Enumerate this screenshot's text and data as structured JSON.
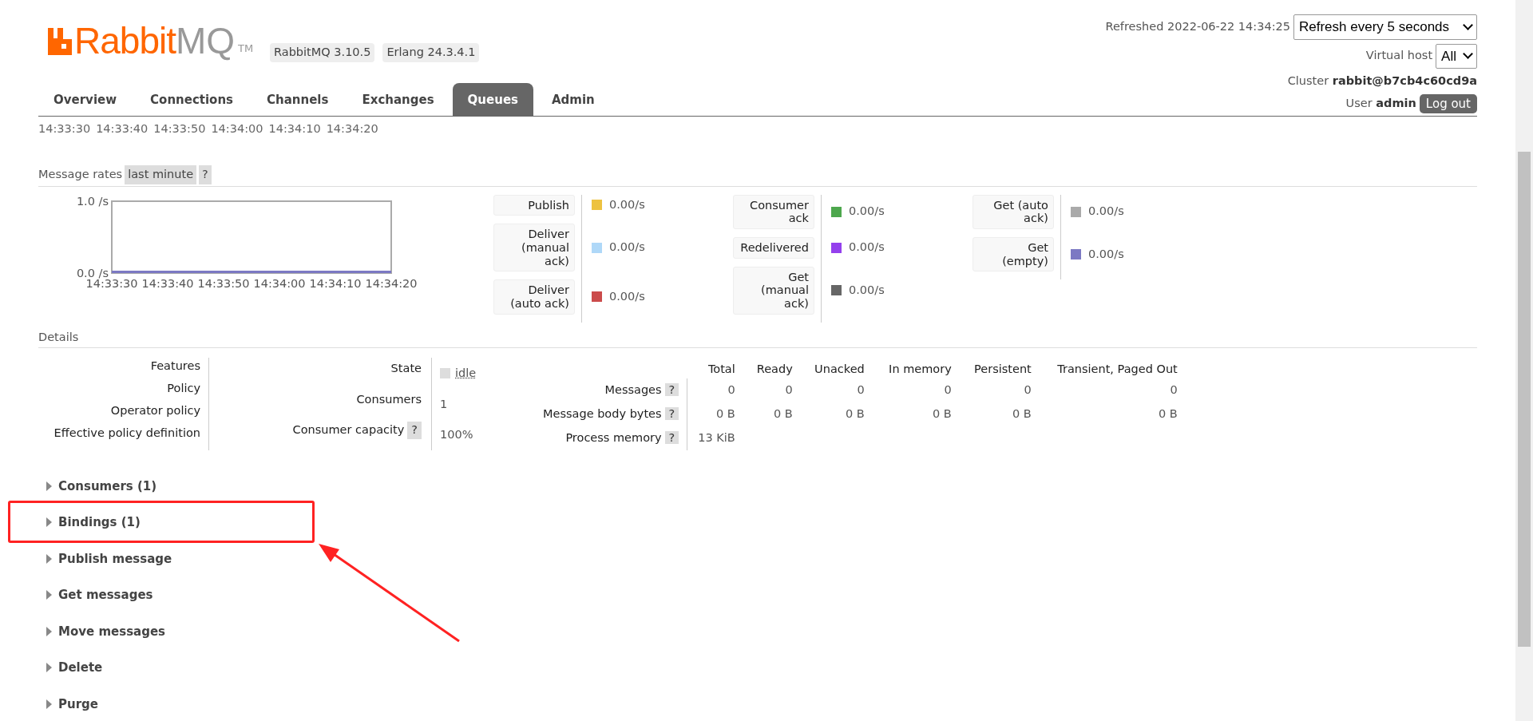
{
  "header": {
    "logo": {
      "brand": "Rabbit",
      "suffix": "MQ",
      "tm": "TM"
    },
    "versions": [
      "RabbitMQ 3.10.5",
      "Erlang 24.3.4.1"
    ],
    "refreshed": "Refreshed 2022-06-22 14:34:25",
    "refresh_select": "Refresh every 5 seconds",
    "vhost_label": "Virtual host",
    "vhost_select": "All",
    "cluster_label": "Cluster",
    "cluster": "rabbit@b7cb4c60cd9a",
    "user_label": "User",
    "user": "admin",
    "logout": "Log out"
  },
  "tabs": [
    {
      "label": "Overview",
      "selected": false
    },
    {
      "label": "Connections",
      "selected": false
    },
    {
      "label": "Channels",
      "selected": false
    },
    {
      "label": "Exchanges",
      "selected": false
    },
    {
      "label": "Queues",
      "selected": true
    },
    {
      "label": "Admin",
      "selected": false
    }
  ],
  "prev_chart_times": [
    "14:33:30",
    "14:33:40",
    "14:33:50",
    "14:34:00",
    "14:34:10",
    "14:34:20"
  ],
  "message_rates": {
    "title": "Message rates",
    "range": "last minute",
    "help": "?",
    "chart_data": {
      "type": "line",
      "x": [
        "14:33:30",
        "14:33:40",
        "14:33:50",
        "14:34:00",
        "14:34:10",
        "14:34:20"
      ],
      "ylim": [
        0,
        1
      ],
      "yticks": [
        {
          "value": 0,
          "label": "0.0 /s"
        },
        {
          "value": 1,
          "label": "1.0 /s"
        }
      ],
      "series": [
        {
          "color": "#7c79c3",
          "values": [
            0,
            0,
            0,
            0,
            0,
            0
          ]
        }
      ]
    },
    "legend": [
      [
        {
          "label": "Publish",
          "color": "#edc240",
          "value": "0.00/s"
        },
        {
          "label": "Deliver (manual ack)",
          "color": "#afd8f8",
          "value": "0.00/s"
        },
        {
          "label": "Deliver (auto ack)",
          "color": "#cb4b4b",
          "value": "0.00/s"
        }
      ],
      [
        {
          "label": "Consumer ack",
          "color": "#4da74d",
          "value": "0.00/s"
        },
        {
          "label": "Redelivered",
          "color": "#9440ed",
          "value": "0.00/s"
        },
        {
          "label": "Get (manual ack)",
          "color": "#666666",
          "value": "0.00/s"
        }
      ],
      [
        {
          "label": "Get (auto ack)",
          "color": "#aaaaaa",
          "value": "0.00/s"
        },
        {
          "label": "Get (empty)",
          "color": "#7c79c3",
          "value": "0.00/s"
        }
      ]
    ]
  },
  "details": {
    "title": "Details",
    "properties": [
      "Features",
      "Policy",
      "Operator policy",
      "Effective policy definition"
    ],
    "queue_stats": [
      {
        "label": "State",
        "value": "idle",
        "kind": "state"
      },
      {
        "label": "Consumers",
        "value": "1",
        "kind": "plain"
      },
      {
        "label": "Consumer capacity",
        "help": "?",
        "value": "100%",
        "kind": "plain"
      }
    ],
    "memory": {
      "columns": [
        "Total",
        "Ready",
        "Unacked",
        "In memory",
        "Persistent",
        "Transient, Paged Out"
      ],
      "rows": [
        {
          "label": "Messages",
          "help": "?",
          "cells": [
            "0",
            "0",
            "0",
            "0",
            "0",
            "0"
          ]
        },
        {
          "label": "Message body bytes",
          "help": "?",
          "cells": [
            "0 B",
            "0 B",
            "0 B",
            "0 B",
            "0 B",
            "0 B"
          ]
        },
        {
          "label": "Process memory",
          "help": "?",
          "cells": [
            "13 KiB"
          ]
        }
      ]
    }
  },
  "sections": [
    {
      "label": "Consumers (1)",
      "expanded": false,
      "highlighted": false
    },
    {
      "label": "Bindings (1)",
      "expanded": false,
      "highlighted": true
    },
    {
      "label": "Publish message",
      "expanded": false,
      "highlighted": false
    },
    {
      "label": "Get messages",
      "expanded": false,
      "highlighted": false
    },
    {
      "label": "Move messages",
      "expanded": false,
      "highlighted": false
    },
    {
      "label": "Delete",
      "expanded": false,
      "highlighted": false
    },
    {
      "label": "Purge",
      "expanded": false,
      "highlighted": false
    }
  ]
}
